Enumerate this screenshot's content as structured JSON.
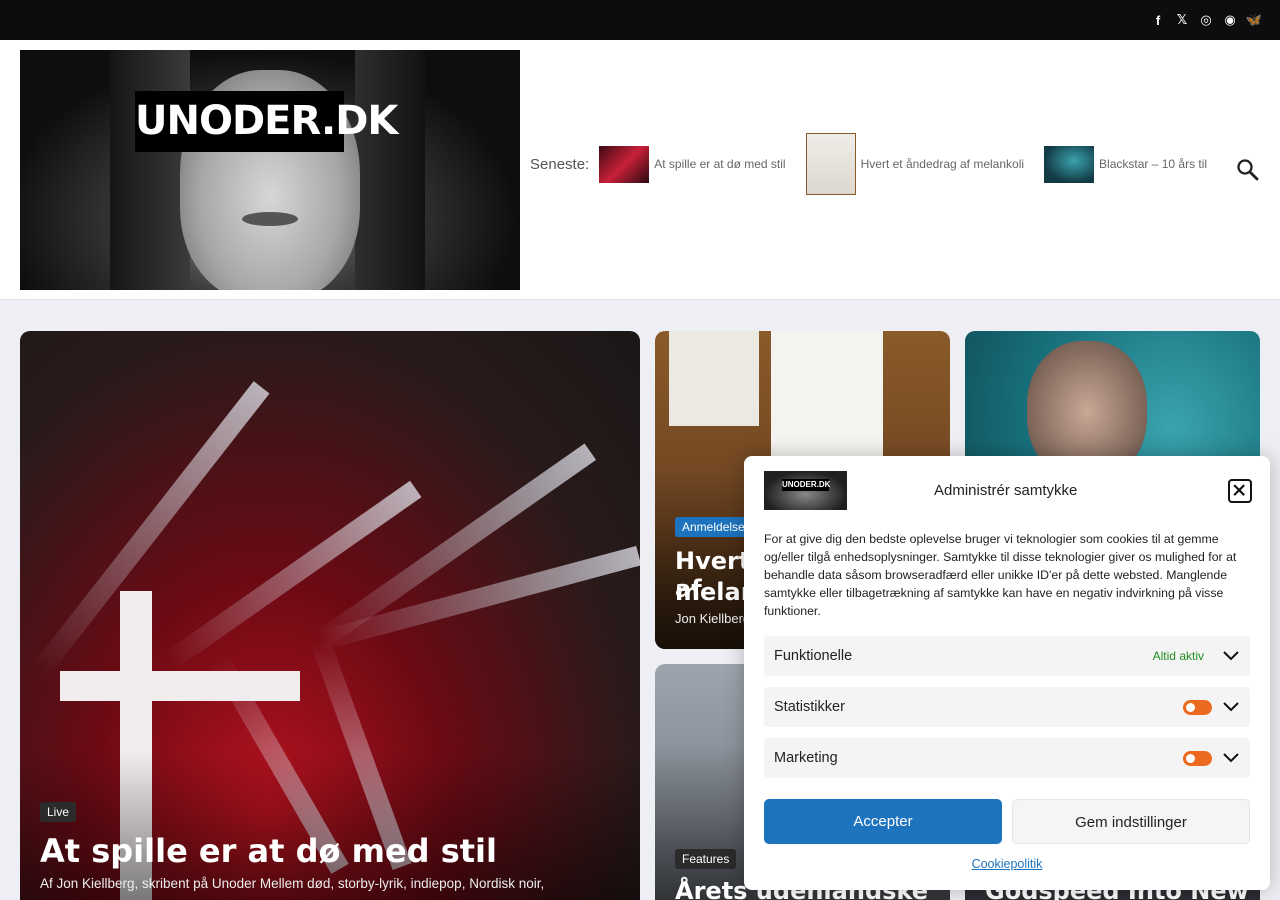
{
  "topbar": {
    "social": [
      {
        "icon": "facebook-icon",
        "glyph": "f"
      },
      {
        "icon": "x-icon",
        "glyph": "𝕏"
      },
      {
        "icon": "instagram-icon",
        "glyph": "◎"
      },
      {
        "icon": "podcast-icon",
        "glyph": "◉"
      },
      {
        "icon": "bluesky-icon",
        "glyph": "🦋"
      }
    ]
  },
  "header": {
    "logo_text": "UNODER.DK",
    "latest_label": "Seneste:",
    "latest": [
      {
        "title": "At spille er at dø med stil"
      },
      {
        "title": "Hvert et åndedrag af melankoli"
      },
      {
        "title": "Blackstar – 10 års til"
      }
    ]
  },
  "cards": {
    "big": {
      "tag": "Live",
      "title": "At spille er at dø med stil",
      "meta": "Af Jon Kiellberg, skribent på Unoder Mellem død, storby-lyrik, indiepop, Nordisk noir,"
    },
    "m1": {
      "tag": "Anmeldelse",
      "title_line1": "Hvert et åndedrag af",
      "title_line2": "melankoli",
      "meta": "Jon Kiellberg"
    },
    "m2": {
      "tag": "Features",
      "title": "Årets udenlandske"
    },
    "r2": {
      "title": "Godspeed Into New"
    }
  },
  "consent": {
    "title": "Administrér samtykke",
    "logo_text": "UNODER.DK",
    "body": "For at give dig den bedste oplevelse bruger vi teknologier som cookies til at gemme og/eller tilgå enhedsoplysninger. Samtykke til disse teknologier giver os mulighed for at behandle data såsom browseradfærd eller unikke ID'er på dette websted. Manglende samtykke eller tilbagetrækning af samtykke kan have en negativ indvirkning på visse funktioner.",
    "rows": [
      {
        "label": "Funktionelle",
        "status": "Altid aktiv"
      },
      {
        "label": "Statistikker"
      },
      {
        "label": "Marketing"
      }
    ],
    "accept_label": "Accepter",
    "save_label": "Gem indstillinger",
    "policy_link": "Cookiepolitik",
    "toggle_color": "#eb6a1f",
    "accent": "#1e73be"
  }
}
